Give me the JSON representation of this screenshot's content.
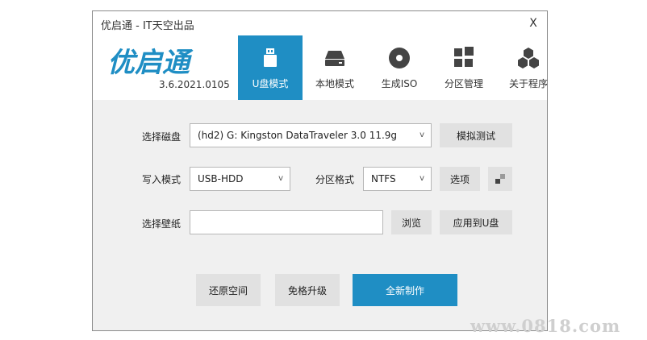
{
  "window": {
    "title": "优启通 - IT天空出品",
    "close_label": "X"
  },
  "header": {
    "logo_text": "优启通",
    "version": "3.6.2021.0105",
    "nav": [
      {
        "label": "U盘模式",
        "icon": "usb-drive-icon",
        "active": true
      },
      {
        "label": "本地模式",
        "icon": "hard-drive-icon",
        "active": false
      },
      {
        "label": "生成ISO",
        "icon": "disc-icon",
        "active": false
      },
      {
        "label": "分区管理",
        "icon": "partition-grid-icon",
        "active": false
      },
      {
        "label": "关于程序",
        "icon": "hexagon-cluster-icon",
        "active": false
      }
    ]
  },
  "form": {
    "disk_label": "选择磁盘",
    "disk_value": "(hd2) G: Kingston DataTraveler 3.0 11.9g",
    "simulate_button": "模拟测试",
    "write_mode_label": "写入模式",
    "write_mode_value": "USB-HDD",
    "partition_format_label": "分区格式",
    "partition_format_value": "NTFS",
    "options_button": "选项",
    "wallpaper_label": "选择壁纸",
    "wallpaper_value": "",
    "browse_button": "浏览",
    "apply_button": "应用到U盘"
  },
  "actions": {
    "restore_button": "还原空间",
    "upgrade_button": "免格升级",
    "create_button": "全新制作"
  },
  "dropdown_arrow": "v",
  "watermark": "www.0818.com",
  "colors": {
    "accent": "#1f8ec4",
    "button_bg": "#e1e1e1",
    "panel_bg": "#f0f0f0"
  }
}
